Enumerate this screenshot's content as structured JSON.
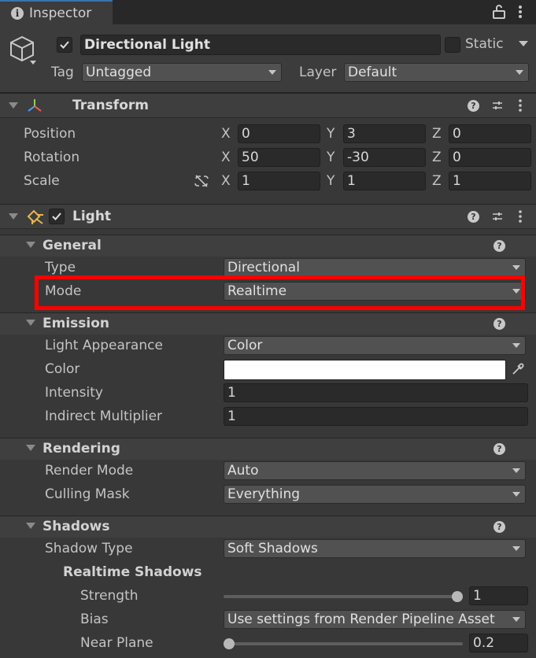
{
  "tab": {
    "title": "Inspector",
    "info_icon": "info-icon"
  },
  "header": {
    "object_name": "Directional Light",
    "active": true,
    "static_label": "Static",
    "tag_label": "Tag",
    "tag_value": "Untagged",
    "layer_label": "Layer",
    "layer_value": "Default"
  },
  "transform": {
    "title": "Transform",
    "rows": [
      {
        "label": "Position",
        "x": "0",
        "y": "3",
        "z": "0"
      },
      {
        "label": "Rotation",
        "x": "50",
        "y": "-30",
        "z": "0"
      },
      {
        "label": "Scale",
        "x": "1",
        "y": "1",
        "z": "1"
      }
    ],
    "axis_x": "X",
    "axis_y": "Y",
    "axis_z": "Z"
  },
  "light": {
    "title": "Light",
    "enabled": true,
    "general": {
      "title": "General",
      "type_label": "Type",
      "type_value": "Directional",
      "mode_label": "Mode",
      "mode_value": "Realtime"
    },
    "emission": {
      "title": "Emission",
      "appearance_label": "Light Appearance",
      "appearance_value": "Color",
      "color_label": "Color",
      "color_value": "#ffffff",
      "intensity_label": "Intensity",
      "intensity_value": "1",
      "indirect_label": "Indirect Multiplier",
      "indirect_value": "1"
    },
    "rendering": {
      "title": "Rendering",
      "render_mode_label": "Render Mode",
      "render_mode_value": "Auto",
      "culling_label": "Culling Mask",
      "culling_value": "Everything"
    },
    "shadows": {
      "title": "Shadows",
      "type_label": "Shadow Type",
      "type_value": "Soft Shadows",
      "realtime_title": "Realtime Shadows",
      "strength_label": "Strength",
      "strength_value": "1",
      "strength_fraction": 1.0,
      "bias_label": "Bias",
      "bias_value": "Use settings from Render Pipeline Asset",
      "near_plane_label": "Near Plane",
      "near_plane_value": "0.2",
      "near_plane_fraction": 0.0
    }
  },
  "colors": {
    "highlight": "#ff0000",
    "accent": "#3a72b0"
  }
}
